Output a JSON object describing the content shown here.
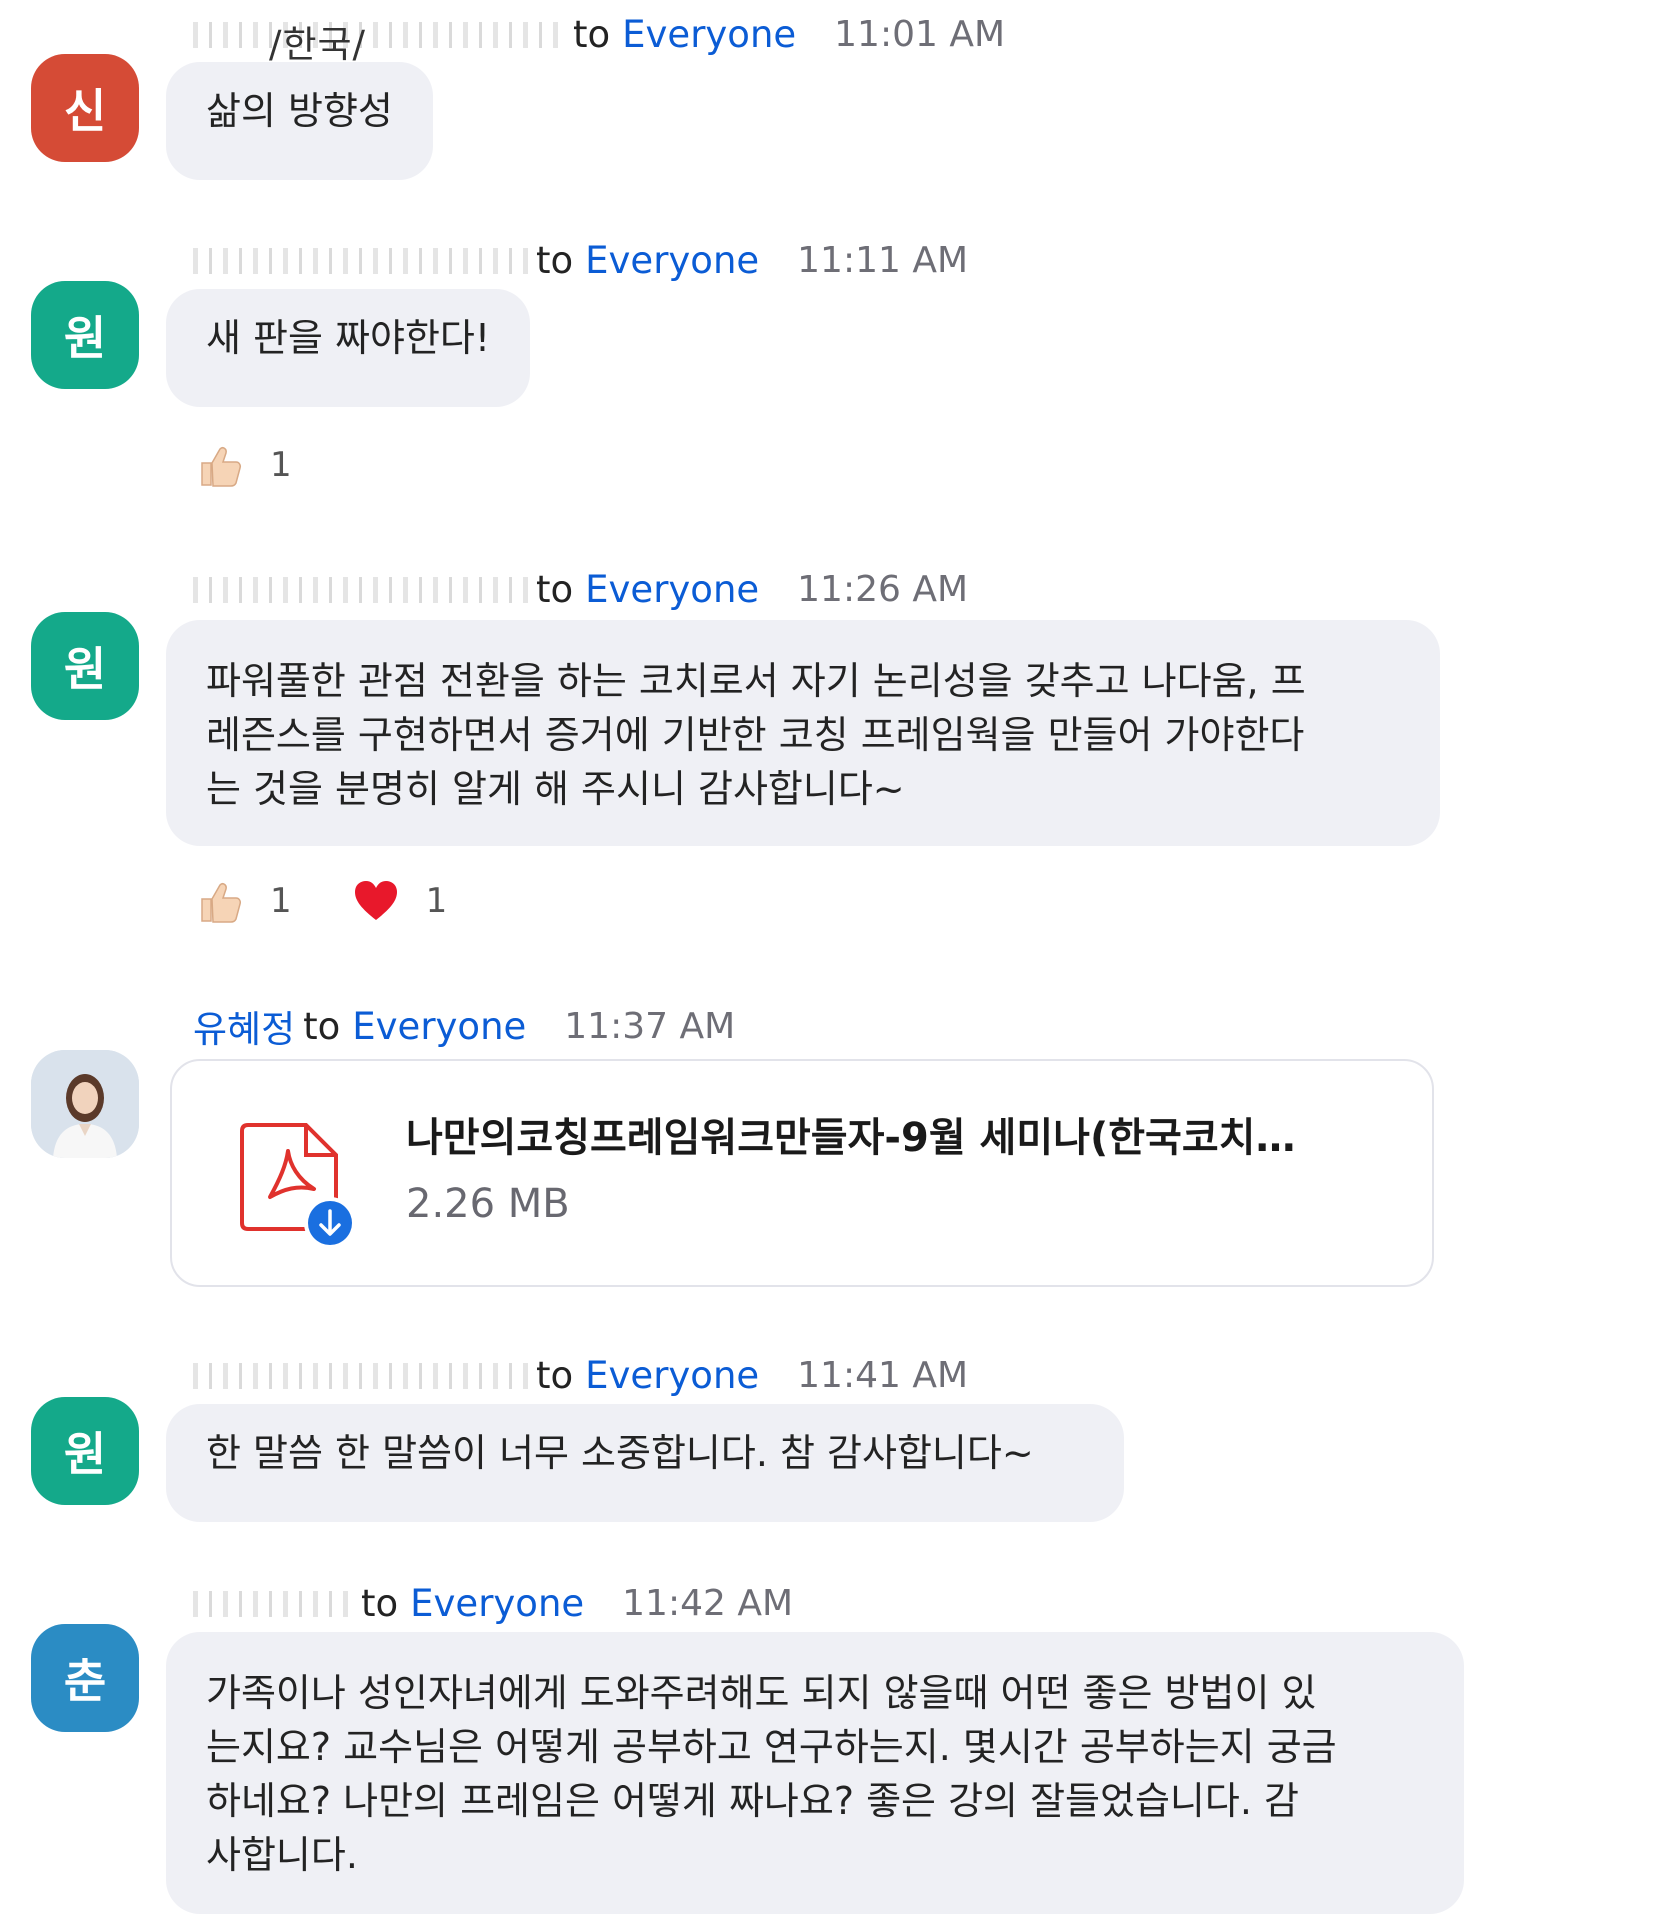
{
  "colors": {
    "link_blue": "#0b5cd5",
    "bubble_bg": "#eff0f5",
    "avatar_red": "#d54b36",
    "avatar_green": "#14a98a",
    "avatar_blue": "#2b8cc4",
    "pdf_red": "#e0322d"
  },
  "common": {
    "to": "to",
    "everyone": "Everyone"
  },
  "messages": [
    {
      "avatar_letter": "신",
      "sender": "/한국/",
      "time": "11:01 AM",
      "text": "삶의 방향성"
    },
    {
      "avatar_letter": "원",
      "sender": "",
      "time": "11:11 AM",
      "text": "새 판을 짜야한다!",
      "reactions": [
        {
          "icon": "thumbs-up-icon",
          "count": "1"
        }
      ]
    },
    {
      "avatar_letter": "원",
      "sender": "",
      "time": "11:26 AM",
      "text_lines": [
        "파워풀한 관점 전환을 하는 코치로서 자기 논리성을 갖추고 나다움, 프",
        "레즌스를 구현하면서 증거에 기반한 코칭 프레임웍을 만들어 가야한다",
        "는 것을 분명히 알게 해 주시니 감사합니다~"
      ],
      "reactions": [
        {
          "icon": "thumbs-up-icon",
          "count": "1"
        },
        {
          "icon": "heart-icon",
          "count": "1"
        }
      ]
    },
    {
      "avatar_icon": "profile-photo",
      "sender": "유혜정",
      "time": "11:37 AM",
      "file": {
        "icon": "pdf-download-icon",
        "name": "나만의코칭프레임워크만들자-9월 세미나(한국코치…",
        "size": "2.26 MB"
      }
    },
    {
      "avatar_letter": "원",
      "sender": "",
      "time": "11:41 AM",
      "text": "한 말씀 한 말씀이 너무 소중합니다. 참 감사합니다~"
    },
    {
      "avatar_letter": "춘",
      "sender": "",
      "time": "11:42 AM",
      "text_lines": [
        "가족이나 성인자녀에게 도와주려해도 되지 않을때 어떤 좋은 방법이 있",
        "는지요? 교수님은 어떻게 공부하고 연구하는지. 몇시간 공부하는지 궁금",
        "하네요?  나만의 프레임은 어떻게 짜나요? 좋은 강의 잘들었습니다. 감",
        "사합니다."
      ]
    }
  ]
}
